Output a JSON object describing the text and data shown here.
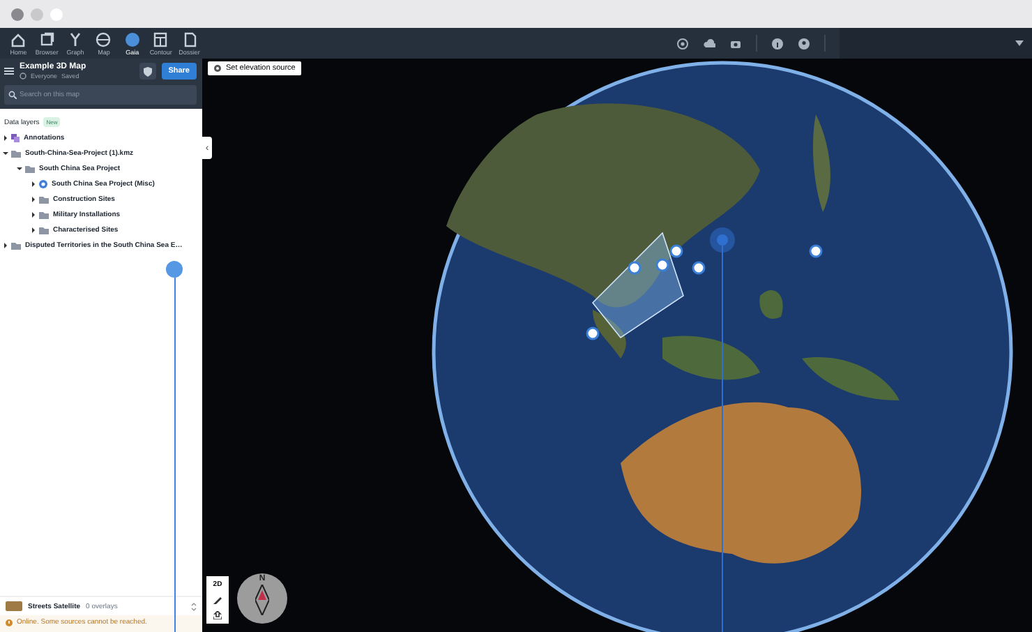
{
  "nav": {
    "items": [
      {
        "label": "Home",
        "selected": false
      },
      {
        "label": "Browser",
        "selected": false
      },
      {
        "label": "Graph",
        "selected": false
      },
      {
        "label": "Map",
        "selected": false
      },
      {
        "label": "Gaia",
        "selected": true
      },
      {
        "label": "Contour",
        "selected": false
      },
      {
        "label": "Dossier",
        "selected": false
      }
    ]
  },
  "sidebar": {
    "title": "Example 3D Map",
    "sharing": "Everyone",
    "status": "Saved",
    "share_button": "Share",
    "search": {
      "placeholder": "Search on this map"
    },
    "layers_heading": "Data layers",
    "badge": "New",
    "layers": [
      {
        "kind": "annotations",
        "label": "Annotations",
        "expanded": false
      },
      {
        "kind": "folder",
        "label": "South-China-Sea-Project (1).kmz",
        "expanded": true,
        "children": [
          {
            "kind": "folder",
            "label": "South China Sea Project",
            "expanded": true,
            "children": [
              {
                "kind": "layer",
                "label": "South China Sea Project (Misc)",
                "expanded": false
              },
              {
                "kind": "folder",
                "label": "Construction Sites",
                "expanded": false
              },
              {
                "kind": "folder",
                "label": "Military Installations",
                "expanded": false
              },
              {
                "kind": "folder",
                "label": "Characterised Sites",
                "expanded": false
              }
            ]
          }
        ]
      },
      {
        "kind": "folder",
        "label": "Disputed Territories in the South China Sea E…",
        "expanded": false
      }
    ],
    "basemap": {
      "name": "Streets Satellite",
      "overlays": "0 overlays"
    },
    "connection": {
      "message": "Online. Some sources cannot be reached."
    }
  },
  "map": {
    "elevation_button": "Set elevation source",
    "collapse_tab": "‹",
    "view_toggle": "2D",
    "compass": "N"
  }
}
